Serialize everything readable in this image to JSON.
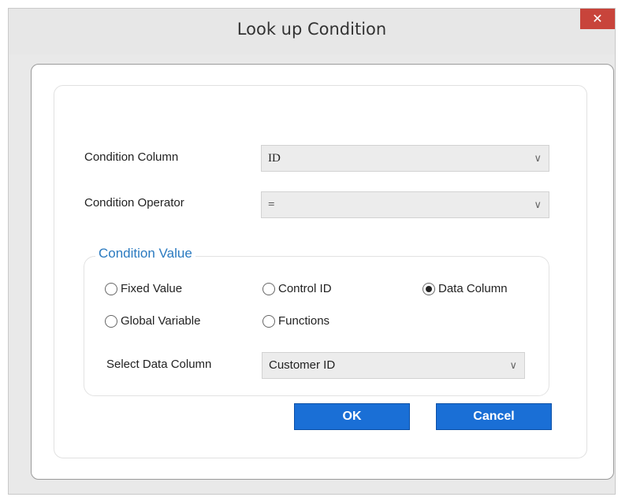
{
  "window": {
    "title": "Look up Condition",
    "close_glyph": "✕"
  },
  "form": {
    "condition_column_label": "Condition Column",
    "condition_column_value": "ID",
    "condition_operator_label": "Condition Operator",
    "condition_operator_value": "="
  },
  "condition_value": {
    "legend": "Condition Value",
    "options": [
      {
        "label": "Fixed Value",
        "checked": false
      },
      {
        "label": "Control ID",
        "checked": false
      },
      {
        "label": "Data Column",
        "checked": true
      },
      {
        "label": "Global Variable",
        "checked": false
      },
      {
        "label": "Functions",
        "checked": false
      }
    ],
    "select_label": "Select Data Column",
    "select_value": "Customer ID"
  },
  "buttons": {
    "ok": "OK",
    "cancel": "Cancel"
  },
  "icons": {
    "chevron": "chevron-down-icon",
    "close": "close-icon"
  },
  "colors": {
    "accent": "#1a6fd6",
    "legend": "#2a7ac0",
    "close": "#c8443b"
  }
}
